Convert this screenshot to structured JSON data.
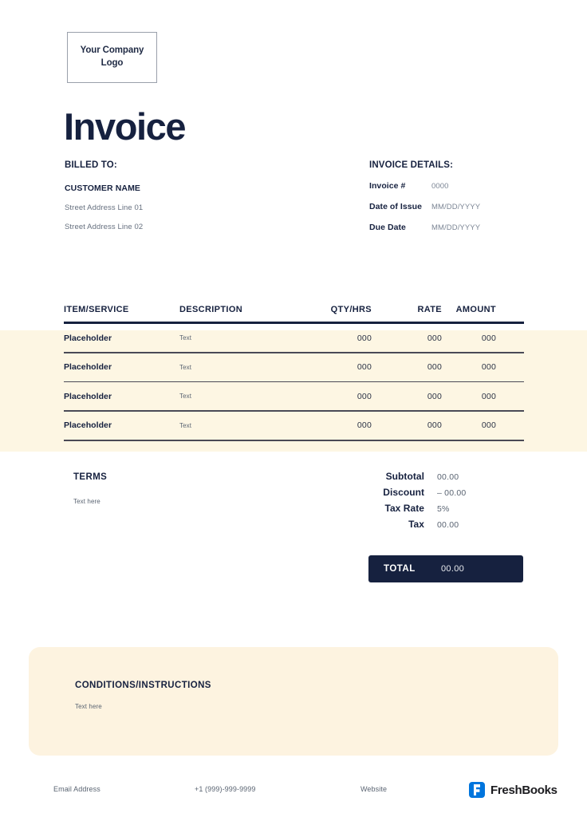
{
  "logo": {
    "line1": "Your Company",
    "line2": "Logo"
  },
  "title": "Invoice",
  "billed_to": {
    "heading": "BILLED TO:",
    "customer_name": "CUSTOMER NAME",
    "address_line_1": "Street Address Line 01",
    "address_line_2": "Street Address Line 02"
  },
  "invoice_details": {
    "heading": "INVOICE DETAILS:",
    "rows": [
      {
        "key": "Invoice #",
        "value": "0000"
      },
      {
        "key": "Date of Issue",
        "value": "MM/DD/YYYY"
      },
      {
        "key": "Due Date",
        "value": "MM/DD/YYYY"
      }
    ]
  },
  "table": {
    "columns": [
      "ITEM/SERVICE",
      "DESCRIPTION",
      "QTY/HRS",
      "RATE",
      "AMOUNT"
    ],
    "rows": [
      {
        "item": "Placeholder",
        "description": "Text",
        "qty": "000",
        "rate": "000",
        "amount": "000"
      },
      {
        "item": "Placeholder",
        "description": "Text",
        "qty": "000",
        "rate": "000",
        "amount": "000"
      },
      {
        "item": "Placeholder",
        "description": "Text",
        "qty": "000",
        "rate": "000",
        "amount": "000"
      },
      {
        "item": "Placeholder",
        "description": "Text",
        "qty": "000",
        "rate": "000",
        "amount": "000"
      }
    ]
  },
  "terms": {
    "heading": "TERMS",
    "text": "Text here"
  },
  "totals": {
    "rows": [
      {
        "key": "Subtotal",
        "value": "00.00"
      },
      {
        "key": "Discount",
        "value": "– 00.00"
      },
      {
        "key": "Tax Rate",
        "value": "5%"
      },
      {
        "key": "Tax",
        "value": "00.00"
      }
    ],
    "total_label": "TOTAL",
    "total_value": "00.00"
  },
  "conditions": {
    "heading": "CONDITIONS/INSTRUCTIONS",
    "text": "Text here"
  },
  "footer": {
    "email": "Email Address",
    "phone": "+1 (999)-999-9999",
    "website": "Website",
    "brand": "FreshBooks"
  },
  "colors": {
    "navy": "#16213f",
    "cream_table": "#fdf6e3",
    "cream_box": "#fdf3e0",
    "muted_text": "#5a6472",
    "brand_blue": "#0075dd"
  }
}
